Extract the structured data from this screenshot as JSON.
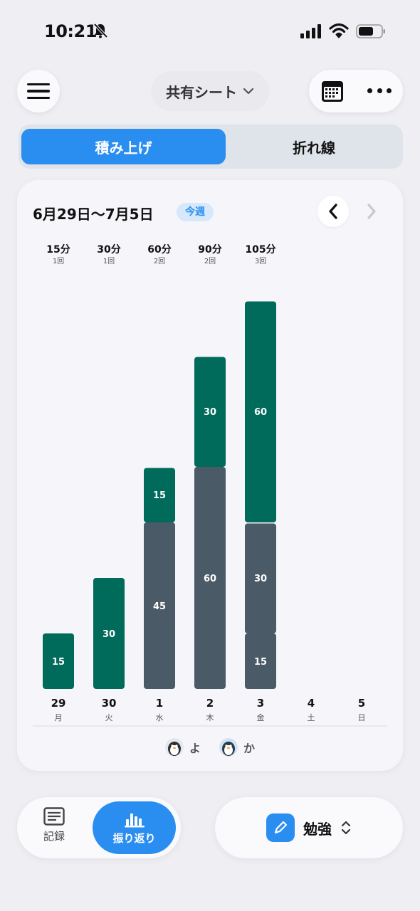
{
  "status": {
    "time": "10:21"
  },
  "header": {
    "sheet_label": "共有シート"
  },
  "segment": {
    "stacked_label": "積み上げ",
    "line_label": "折れ線"
  },
  "card": {
    "range_title": "6月29日〜7月5日",
    "week_badge": "今週"
  },
  "colors": {
    "accent": "#2a8ef0",
    "series_you": "#4a5a66",
    "series_ka": "#006b5a"
  },
  "chart_data": {
    "type": "bar",
    "stacked": true,
    "categories": [
      "29",
      "30",
      "1",
      "2",
      "3",
      "4",
      "5"
    ],
    "weekdays": [
      "月",
      "火",
      "水",
      "木",
      "金",
      "土",
      "日"
    ],
    "totals": [
      "15分",
      "30分",
      "60分",
      "90分",
      "105分",
      "",
      ""
    ],
    "counts": [
      "1回",
      "1回",
      "2回",
      "2回",
      "3回",
      "",
      ""
    ],
    "series": [
      {
        "name": "よ",
        "color": "#4a5a66",
        "segments": [
          [],
          [],
          [
            45
          ],
          [
            60
          ],
          [
            15,
            30
          ],
          [],
          []
        ]
      },
      {
        "name": "か",
        "color": "#006b5a",
        "segments": [
          [
            15
          ],
          [
            30
          ],
          [
            15
          ],
          [
            30
          ],
          [
            60
          ],
          [],
          []
        ]
      }
    ],
    "ylim": [
      0,
      105
    ]
  },
  "legend": [
    {
      "label": "よ",
      "icon": "penguin-avatar-icon"
    },
    {
      "label": "か",
      "icon": "penguin-avatar-icon"
    }
  ],
  "tabbar": {
    "record_label": "記録",
    "review_label": "振り返り"
  },
  "subject": {
    "label": "勉強"
  }
}
